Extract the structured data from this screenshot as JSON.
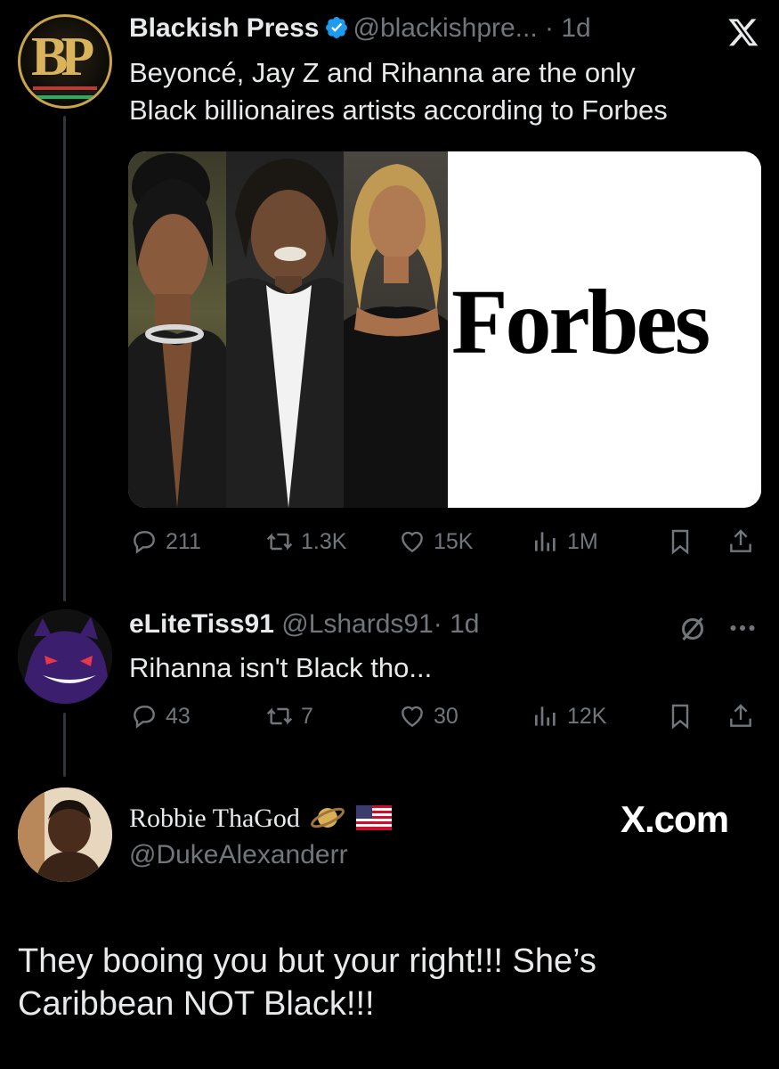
{
  "tweet1": {
    "name": "Blackish Press",
    "handle": "@blackishpre...",
    "time": "· 1d",
    "text_line1": "Beyoncé, Jay Z and Rihanna are the only",
    "text_line2": "Black billionaires artists according to Forbes",
    "media_word": "Forbes",
    "avatar_letters": "BP",
    "stats": {
      "replies": "211",
      "retweets": "1.3K",
      "likes": "15K",
      "views": "1M"
    }
  },
  "tweet2": {
    "name": "eLiteTiss91",
    "handle": "@Lshards91",
    "time": "· 1d",
    "text": "Rihanna isn't Black tho...",
    "stats": {
      "replies": "43",
      "retweets": "7",
      "likes": "30",
      "views": "12K"
    }
  },
  "tweet3": {
    "name": "Robbie ThaGod",
    "handle": "@DukeAlexanderr",
    "brand": "X.com",
    "text": "They booing you but your right!!! She’s Caribbean NOT Black!!!"
  },
  "colors": {
    "background": "#000000",
    "text": "#e7e9ea",
    "muted": "#71767b",
    "verified": "#1d9bf0",
    "thread_line": "#333639"
  },
  "icons": [
    "x-logo-icon",
    "verified-badge-icon",
    "reply-icon",
    "retweet-icon",
    "like-icon",
    "views-icon",
    "bookmark-icon",
    "share-icon",
    "grok-slash-icon",
    "more-icon",
    "saturn-emoji-icon",
    "us-flag-emoji-icon"
  ]
}
